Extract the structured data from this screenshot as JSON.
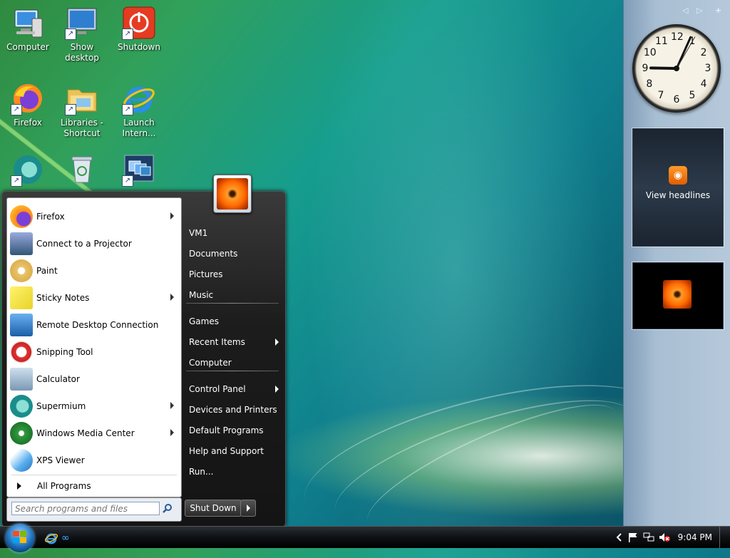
{
  "desktop": {
    "icons": [
      {
        "label": "Computer"
      },
      {
        "label": "Show desktop"
      },
      {
        "label": "Shutdown"
      },
      {
        "label": "Firefox"
      },
      {
        "label": "Libraries - Shortcut"
      },
      {
        "label": "Launch Intern..."
      },
      {
        "label": ""
      },
      {
        "label": ""
      },
      {
        "label": ""
      }
    ]
  },
  "sidebar": {
    "feed_label": "View headlines",
    "clock_numbers": [
      "12",
      "1",
      "2",
      "3",
      "4",
      "5",
      "6",
      "7",
      "8",
      "9",
      "10",
      "11"
    ]
  },
  "start_menu": {
    "programs": [
      {
        "label": "Firefox",
        "icon": "firefox-icon",
        "submenu": true
      },
      {
        "label": "Connect to a Projector",
        "icon": "projector-icon",
        "submenu": false
      },
      {
        "label": "Paint",
        "icon": "paint-icon",
        "submenu": false
      },
      {
        "label": "Sticky Notes",
        "icon": "sticky-notes-icon",
        "submenu": true
      },
      {
        "label": "Remote Desktop Connection",
        "icon": "remote-desktop-icon",
        "submenu": false
      },
      {
        "label": "Snipping Tool",
        "icon": "scissors-icon",
        "submenu": false
      },
      {
        "label": "Calculator",
        "icon": "calculator-icon",
        "submenu": false
      },
      {
        "label": "Supermium",
        "icon": "supermium-icon",
        "submenu": true
      },
      {
        "label": "Windows Media Center",
        "icon": "media-center-icon",
        "submenu": true
      },
      {
        "label": "XPS Viewer",
        "icon": "xps-viewer-icon",
        "submenu": false
      }
    ],
    "all_programs": "All Programs",
    "search_placeholder": "Search programs and files",
    "right_items": [
      {
        "label": "VM1",
        "submenu": false
      },
      {
        "label": "Documents",
        "submenu": false
      },
      {
        "label": "Pictures",
        "submenu": false
      },
      {
        "label": "Music",
        "submenu": false
      },
      {
        "label": "Games",
        "submenu": false
      },
      {
        "label": "Recent Items",
        "submenu": true
      },
      {
        "label": "Computer",
        "submenu": false
      },
      {
        "label": "Control Panel",
        "submenu": true
      },
      {
        "label": "Devices and Printers",
        "submenu": false
      },
      {
        "label": "Default Programs",
        "submenu": false
      },
      {
        "label": "Help and Support",
        "submenu": false
      },
      {
        "label": "Run...",
        "submenu": false
      }
    ],
    "shutdown_label": "Shut Down"
  },
  "taskbar": {
    "clock": "9:04 PM"
  }
}
